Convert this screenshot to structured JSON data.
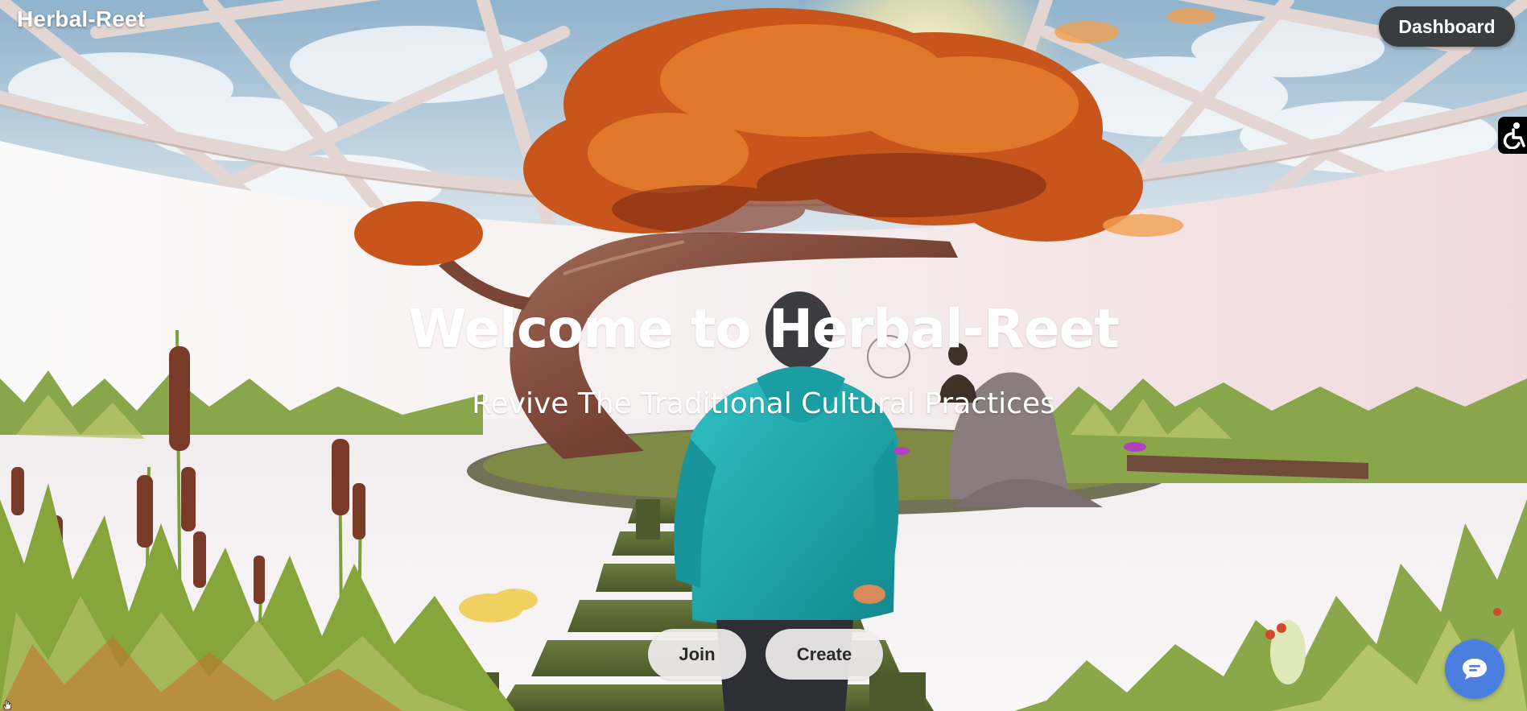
{
  "app": {
    "brand": "Herbal-Reet"
  },
  "header": {
    "dashboard_label": "Dashboard"
  },
  "hero": {
    "title": "Welcome to Herbal-Reet",
    "subtitle": "Revive The Traditional Cultural Practices"
  },
  "actions": {
    "join_label": "Join",
    "create_label": "Create"
  },
  "icons": {
    "accessibility": "accessibility-icon",
    "chat": "chat-icon",
    "cursor": "hand-cursor-icon"
  },
  "colors": {
    "dashboard_bg": "#3a3d40",
    "chat_bg": "#4a7fe0",
    "hoodie": "#1fa3a8",
    "leaves": "#c8561c"
  }
}
